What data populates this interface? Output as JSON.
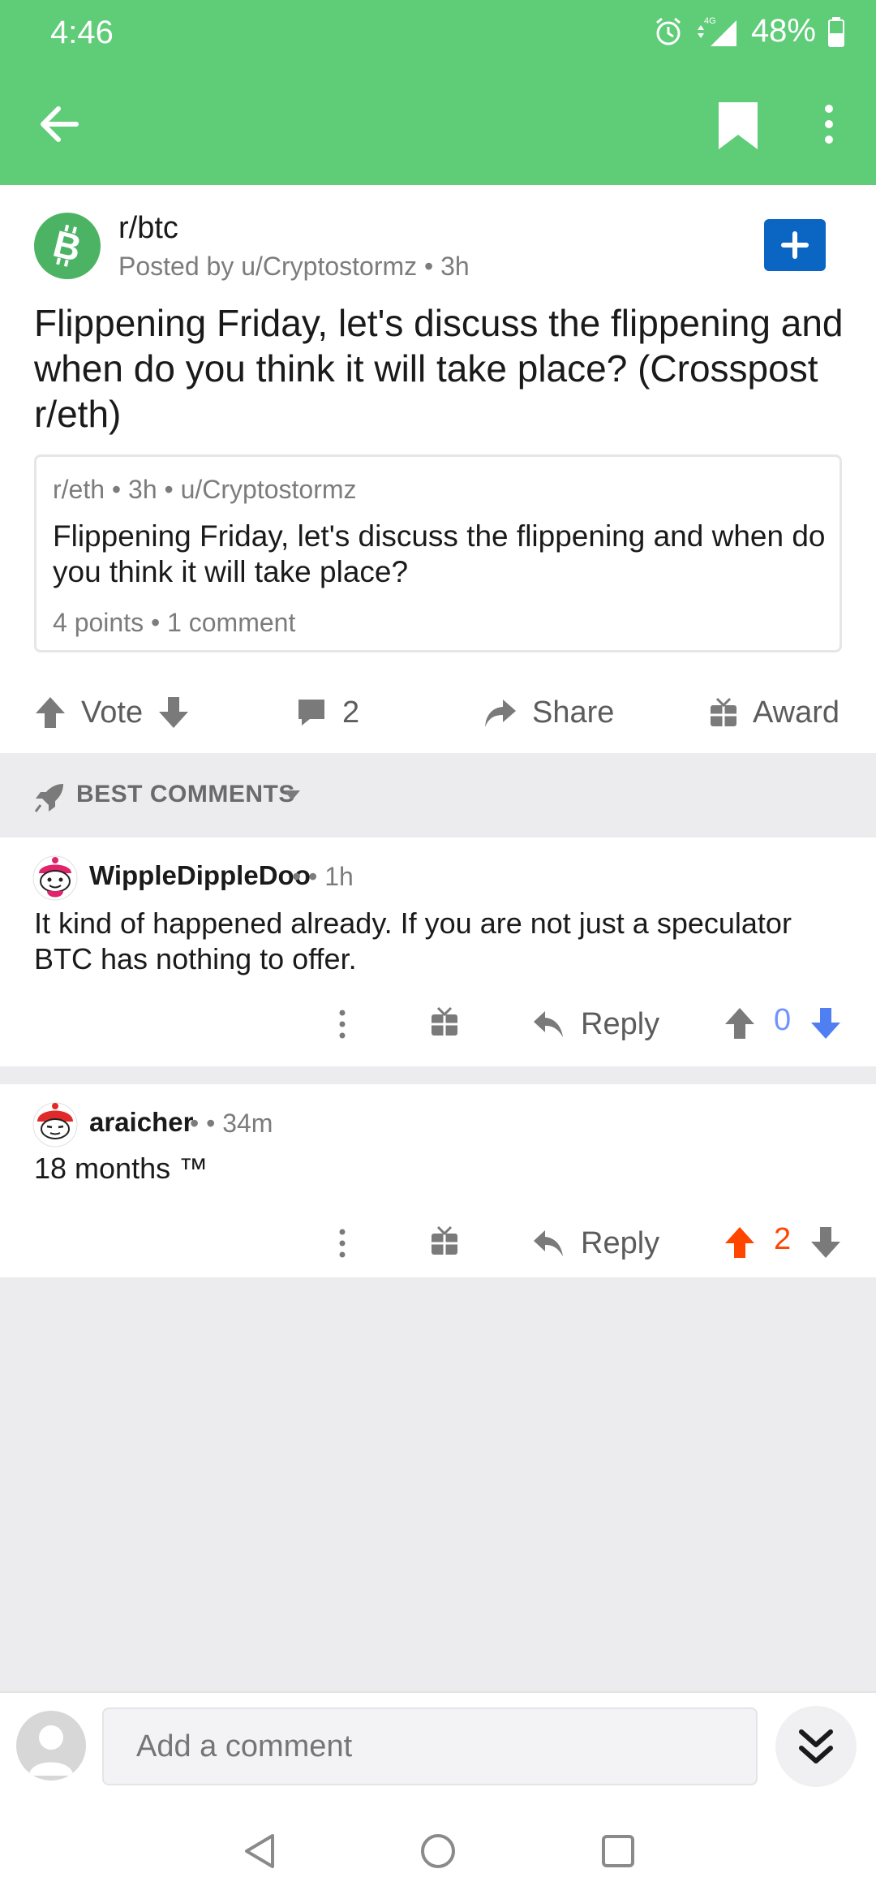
{
  "status": {
    "time": "4:46",
    "network": "4G",
    "battery": "48%"
  },
  "post": {
    "subreddit": "r/btc",
    "posted_by": "Posted by u/Cryptostormz • 3h",
    "title": "Flippening Friday, let's discuss the flippening and when do you think it will take place? (Crosspost r/eth)",
    "crosspost": {
      "meta": "r/eth • 3h • u/Cryptostormz",
      "title": "Flippening Friday, let's discuss the flippening and when do you think it will take place?",
      "stats": "4 points • 1 comment"
    },
    "actions": {
      "vote": "Vote",
      "comments": "2",
      "share": "Share",
      "award": "Award"
    }
  },
  "sort": {
    "label": "BEST COMMENTS"
  },
  "comments": [
    {
      "author": "WippleDippleDoo",
      "time": "• • 1h",
      "body": "It kind of happened already. If you are not just a speculator BTC has nothing to offer.",
      "reply": "Reply",
      "score": "0",
      "vote_state": "none"
    },
    {
      "author": "araicher",
      "time": "• • 34m",
      "body": "18 months ™",
      "reply": "Reply",
      "score": "2",
      "vote_state": "up"
    }
  ],
  "composer": {
    "placeholder": "Add a comment"
  },
  "colors": {
    "brand_green": "#5fcc78",
    "join_blue": "#0a66c2",
    "upvote_orange": "#ff4500",
    "neutral_blue": "#7193ff"
  }
}
